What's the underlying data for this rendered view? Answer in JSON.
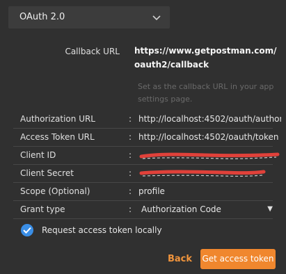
{
  "auth_type": {
    "selected": "OAuth 2.0",
    "icon": "chevron-down-icon"
  },
  "callback": {
    "label": "Callback URL",
    "url": "https://www.getpostman.com/oauth2/callback",
    "help": "Set as the callback URL in your app settings page."
  },
  "fields": [
    {
      "label": "Authorization URL",
      "value": "http://localhost:4502/oauth/author"
    },
    {
      "label": "Access Token URL",
      "value": "http://localhost:4502/oauth/token"
    },
    {
      "label": "Client ID",
      "value": ""
    },
    {
      "label": "Client Secret",
      "value": ""
    },
    {
      "label": "Scope (Optional)",
      "value": "profile"
    },
    {
      "label": "Grant type",
      "value": "Authorization Code"
    }
  ],
  "separator": ":",
  "request_locally": {
    "label": "Request access token locally",
    "checked": true
  },
  "actions": {
    "back": "Back",
    "get_token": "Get access token"
  },
  "colors": {
    "accent": "#f0872e",
    "check": "#3a8ee6",
    "redaction": "#e0413a"
  }
}
